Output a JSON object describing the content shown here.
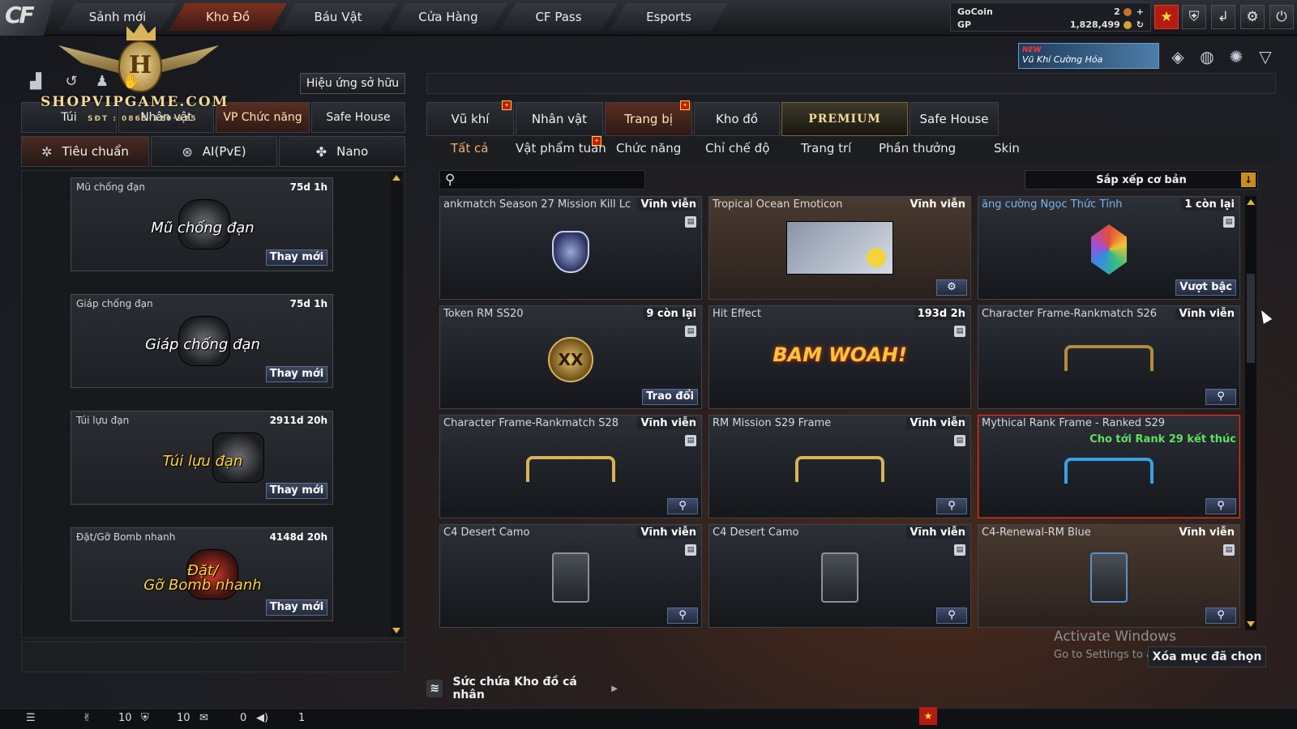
{
  "nav": {
    "logo": "CF",
    "tabs": [
      "Sảnh mới",
      "Kho Đồ",
      "Báu Vật",
      "Cửa Hàng",
      "CF Pass",
      "Esports"
    ],
    "active_tab": "Kho Đồ"
  },
  "currency": {
    "gocoin_label": "GoCoin",
    "gocoin_value": "2",
    "gp_label": "GP",
    "gp_value": "1,828,499"
  },
  "promo": {
    "badge": "NEW",
    "text": "Vũ Khí Cường Hóa"
  },
  "watermark": {
    "shop": "SHOPVIPGAME.COM",
    "phone": "SĐT : 0865·320·925",
    "letter": "H"
  },
  "left": {
    "effect_button": "Hiệu ứng sở hữu",
    "tabs": [
      "Túi",
      "Nhân vật",
      "VP Chức năng",
      "Safe House"
    ],
    "subtabs": [
      "Tiêu chuẩn",
      "AI(PvE)",
      "Nano"
    ],
    "items": [
      {
        "name": "Mũ chống đạn",
        "time": "75d 1h",
        "caption": "Mũ chống đạn",
        "button": "Thay mới"
      },
      {
        "name": "Giáp chống đạn",
        "time": "75d 1h",
        "caption": "Giáp chống đạn",
        "button": "Thay mới"
      },
      {
        "name": "Túi lựu đạn",
        "time": "2911d 20h",
        "caption": "Túi lựu đạn",
        "button": "Thay mới"
      },
      {
        "name": "Đặt/Gỡ Bomb nhanh",
        "time": "4148d 20h",
        "caption": "Đặt/\nGỡ Bomb nhanh",
        "button": "Thay mới"
      }
    ]
  },
  "right": {
    "tabs": [
      "Vũ khí",
      "Nhân vật",
      "Trang bị",
      "Kho đồ",
      "PREMIUM",
      "Safe House"
    ],
    "active_tab": "Trang bị",
    "categories": [
      "Tất cả",
      "Vật phẩm tuần",
      "Chức năng",
      "Chỉ chế độ",
      "Trang trí",
      "Phần thưởng",
      "Skin"
    ],
    "search_placeholder": "",
    "sort_label": "Sắp xếp cơ bản",
    "cards": [
      {
        "name": "ankmatch Season 27 Mission Kill Lc",
        "status": "Vĩnh viễn",
        "visual": "emblem"
      },
      {
        "name": "Tropical Ocean Emoticon",
        "status": "Vĩnh viễn",
        "visual": "emoticon"
      },
      {
        "name": "ăng cường Ngọc Thức Tỉnh",
        "status": "1 còn lại",
        "visual": "gem",
        "button": "Vượt bậc"
      },
      {
        "name": "Token RM SS20",
        "status": "9 còn lại",
        "visual": "token",
        "button": "Trao đổi"
      },
      {
        "name": "Hit Effect",
        "status": "193d 2h",
        "visual": "hit"
      },
      {
        "name": "Character Frame-Rankmatch S26",
        "status": "Vĩnh viễn",
        "visual": "frame"
      },
      {
        "name": "Character Frame-Rankmatch S28",
        "status": "Vĩnh viễn",
        "visual": "frame-gold"
      },
      {
        "name": "RM Mission S29 Frame",
        "status": "Vĩnh viễn",
        "visual": "frame-gold"
      },
      {
        "name": "Mythical Rank Frame - Ranked S29",
        "status": "",
        "note": "Cho tới Rank 29 kết thúc",
        "visual": "frame-blue"
      },
      {
        "name": "C4 Desert Camo",
        "status": "Vĩnh viễn",
        "visual": "c4"
      },
      {
        "name": "C4 Desert Camo",
        "status": "Vĩnh viễn",
        "visual": "c4"
      },
      {
        "name": "C4-Renewal-RM Blue",
        "status": "Vĩnh viễn",
        "visual": "c4"
      }
    ],
    "hit_text": "BAM WOAH!",
    "token_text": "XX",
    "delete_button": "Xóa mục đã chọn",
    "capacity_label": "Sức chứa Kho đồ cá nhân"
  },
  "watermark_os": {
    "title": "Activate Windows",
    "sub": "Go to Settings to a"
  },
  "bottombar": {
    "a": "10",
    "b": "10",
    "c": "0",
    "d": "1"
  },
  "colors": {
    "accent": "#5a2d22",
    "highlight_border": "#d43b2b",
    "note_green": "#5fe05f"
  }
}
